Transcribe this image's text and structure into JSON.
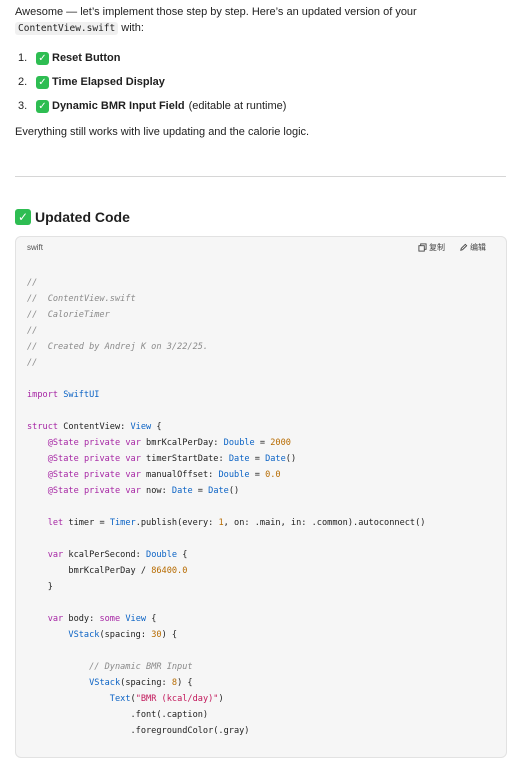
{
  "intro": {
    "line1": "Awesome — let’s implement those step by step. Here’s an updated version of your",
    "file_name": "ContentView.swift",
    "line2_suffix": " with:"
  },
  "features": [
    {
      "num": "1.",
      "title": "Reset Button",
      "tail": ""
    },
    {
      "num": "2.",
      "title": "Time Elapsed Display",
      "tail": ""
    },
    {
      "num": "3.",
      "title": "Dynamic BMR Input Field",
      "tail": "(editable at runtime)"
    }
  ],
  "check_emoji": "✓",
  "summary": "Everything still works with live updating and the calorie logic.",
  "heading": "Updated Code",
  "code_block": {
    "language": "swift",
    "copy_label": "复制",
    "edit_label": "编辑",
    "lines": [
      "//",
      "//  ContentView.swift",
      "//  CalorieTimer",
      "//",
      "//  Created by Andrej K on 3/22/25.",
      "//",
      "",
      "import SwiftUI",
      "",
      "struct ContentView: View {",
      "    @State private var bmrKcalPerDay: Double = 2000",
      "    @State private var timerStartDate: Date = Date()",
      "    @State private var manualOffset: Double = 0.0",
      "    @State private var now: Date = Date()",
      "",
      "    let timer = Timer.publish(every: 1, on: .main, in: .common).autoconnect()",
      "",
      "    var kcalPerSecond: Double {",
      "        bmrKcalPerDay / 86400.0",
      "    }",
      "",
      "    var body: some View {",
      "        VStack(spacing: 30) {",
      "",
      "            // Dynamic BMR Input",
      "            VStack(spacing: 8) {",
      "                Text(\"BMR (kcal/day)\")",
      "                    .font(.caption)",
      "                    .foregroundColor(.gray)"
    ]
  },
  "colors": {
    "check_green": "#2ebd52",
    "code_bg": "#f6f6f6",
    "comment": "#8a8a8a",
    "keyword": "#a626a4",
    "type": "#0b63c5",
    "number": "#b76b01"
  },
  "icons": [
    "copy-icon",
    "edit-icon",
    "check-emoji-icon"
  ]
}
